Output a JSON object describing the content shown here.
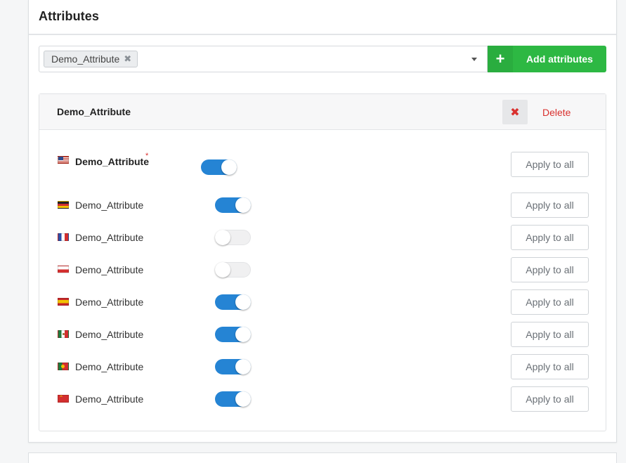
{
  "panel": {
    "title": "Attributes"
  },
  "select": {
    "chip_label": "Demo_Attribute",
    "add_button_label": "Add attributes"
  },
  "attribute_card": {
    "title": "Demo_Attribute",
    "delete_label": "Delete",
    "rows": [
      {
        "flag": "us-flag-icon",
        "label": "Demo_Attribute",
        "required": "*",
        "enabled": true,
        "apply_label": "Apply to all"
      },
      {
        "flag": "de-flag-icon",
        "label": "Demo_Attribute",
        "enabled": true,
        "apply_label": "Apply to all"
      },
      {
        "flag": "fr-flag-icon",
        "label": "Demo_Attribute",
        "enabled": false,
        "apply_label": "Apply to all"
      },
      {
        "flag": "pl-flag-icon",
        "label": "Demo_Attribute",
        "enabled": false,
        "apply_label": "Apply to all"
      },
      {
        "flag": "es-flag-icon",
        "label": "Demo_Attribute",
        "enabled": true,
        "apply_label": "Apply to all"
      },
      {
        "flag": "mx-flag-icon",
        "label": "Demo_Attribute",
        "enabled": true,
        "apply_label": "Apply to all"
      },
      {
        "flag": "pt-flag-icon",
        "label": "Demo_Attribute",
        "enabled": true,
        "apply_label": "Apply to all"
      },
      {
        "flag": "cn-flag-icon",
        "label": "Demo_Attribute",
        "enabled": true,
        "apply_label": "Apply to all"
      }
    ]
  },
  "colors": {
    "accent_blue": "#2584d4",
    "add_green": "#2db843",
    "delete_red": "#d9302e"
  }
}
